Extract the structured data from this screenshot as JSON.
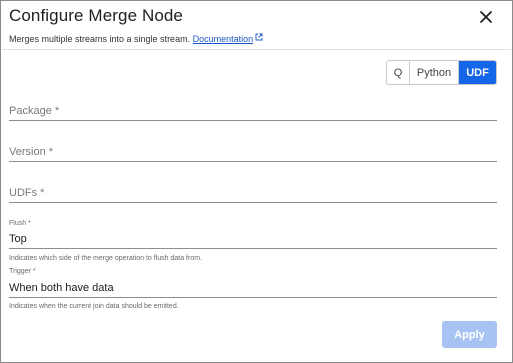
{
  "dialog": {
    "title": "Configure Merge Node",
    "description": "Merges multiple streams into a single stream.",
    "documentation_link": "Documentation"
  },
  "mode_toggle": {
    "options": [
      "Q",
      "Python",
      "UDF"
    ],
    "selected": "UDF"
  },
  "fields": {
    "package": {
      "label": "Package *",
      "value": ""
    },
    "version": {
      "label": "Version *",
      "value": ""
    },
    "udfs": {
      "label": "UDFs *",
      "value": ""
    },
    "flush": {
      "label": "Flush *",
      "value": "Top",
      "helper": "Indicates which side of the merge operation to flush data from."
    },
    "trigger": {
      "label": "Trigger *",
      "value": "When both have data",
      "helper": "Indicates when the current join data should be emitted."
    }
  },
  "actions": {
    "apply_label": "Apply",
    "apply_enabled": false
  },
  "colors": {
    "accent": "#1565e8",
    "apply_disabled": "#a7c3f4",
    "link": "#1a56c8"
  }
}
